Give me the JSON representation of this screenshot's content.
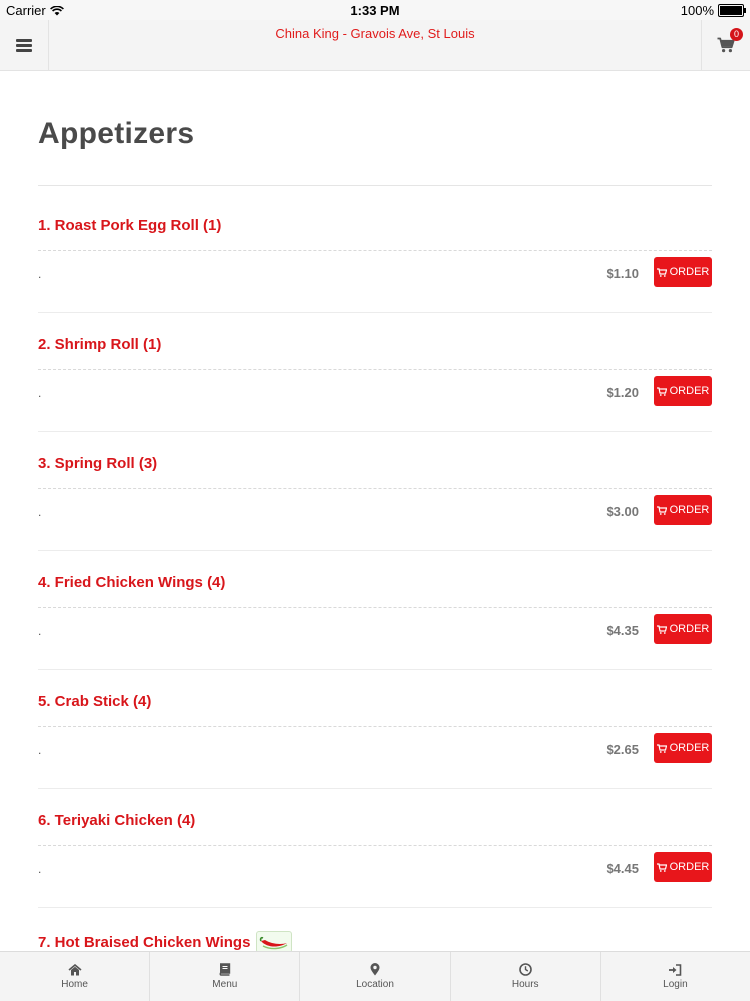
{
  "status_bar": {
    "carrier": "Carrier",
    "time": "1:33 PM",
    "battery": "100%"
  },
  "header": {
    "title": "China King - Gravois Ave, St Louis",
    "cart_count": "0"
  },
  "section": {
    "title": "Appetizers"
  },
  "order_label": "ORDER",
  "items": [
    {
      "name": "1. Roast Pork Egg Roll (1)",
      "description": ".",
      "price": "$1.10"
    },
    {
      "name": "2. Shrimp Roll (1)",
      "description": ".",
      "price": "$1.20"
    },
    {
      "name": "3. Spring Roll (3)",
      "description": ".",
      "price": "$3.00"
    },
    {
      "name": "4. Fried Chicken Wings (4)",
      "description": ".",
      "price": "$4.35"
    },
    {
      "name": "5. Crab Stick (4)",
      "description": ".",
      "price": "$2.65"
    },
    {
      "name": "6. Teriyaki Chicken (4)",
      "description": ".",
      "price": "$4.45"
    },
    {
      "name": "7. Hot Braised Chicken Wings",
      "spicy": true
    }
  ],
  "tabs": [
    {
      "label": "Home",
      "icon": "home-icon"
    },
    {
      "label": "Menu",
      "icon": "book-icon"
    },
    {
      "label": "Location",
      "icon": "map-pin-icon"
    },
    {
      "label": "Hours",
      "icon": "clock-icon"
    },
    {
      "label": "Login",
      "icon": "login-icon"
    }
  ]
}
